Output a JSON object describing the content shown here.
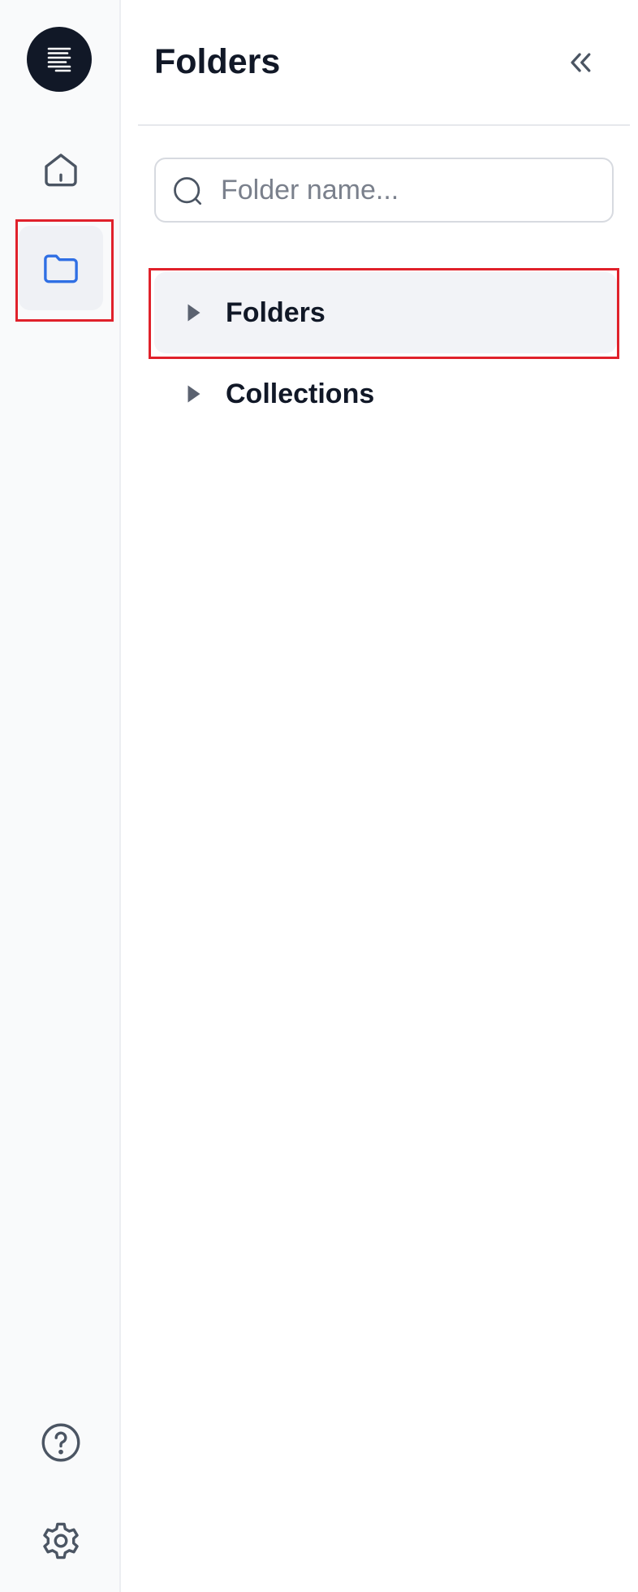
{
  "rail": {
    "logo_icon": "stacked-lines-logo-icon",
    "items": [
      {
        "id": "home",
        "icon": "home-icon",
        "active": false
      },
      {
        "id": "folders",
        "icon": "folder-icon",
        "active": true
      },
      {
        "id": "help",
        "icon": "help-icon",
        "active": false
      },
      {
        "id": "settings",
        "icon": "gear-icon",
        "active": false
      }
    ]
  },
  "panel": {
    "title": "Folders",
    "collapse_icon": "double-chevron-left-icon",
    "search": {
      "placeholder": "Folder name...",
      "value": ""
    },
    "tree": [
      {
        "label": "Folders",
        "selected": true,
        "expanded": false
      },
      {
        "label": "Collections",
        "selected": false,
        "expanded": false
      }
    ]
  },
  "colors": {
    "accent": "#2f6fe4",
    "highlight": "#e0212b",
    "text": "#111827",
    "muted_icon": "#4b5563"
  }
}
